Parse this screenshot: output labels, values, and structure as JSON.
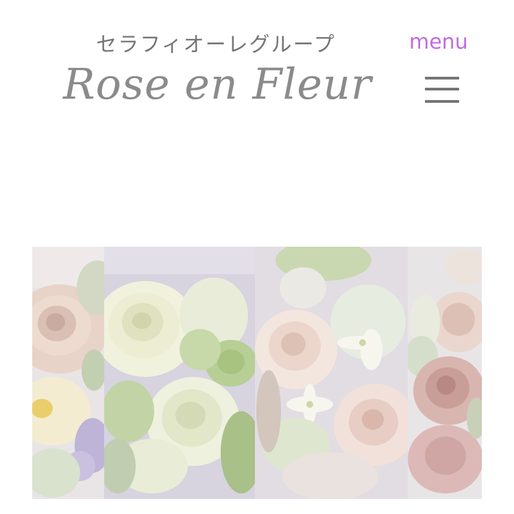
{
  "header": {
    "group_name": "セラフィオーレグループ",
    "brand_name": "Rose en Fleur",
    "menu_label": "menu"
  },
  "icons": {
    "menu": "hamburger-menu-icon"
  },
  "colors": {
    "menu_accent": "#c26be0",
    "text_gray": "#757575",
    "background": "#ffffff"
  },
  "gallery": {
    "panels": [
      {
        "name": "blush-cream-roses-panel"
      },
      {
        "name": "white-green-roses-panel"
      },
      {
        "name": "pink-white-stephanotis-panel"
      },
      {
        "name": "dusty-pink-roses-panel"
      }
    ]
  }
}
